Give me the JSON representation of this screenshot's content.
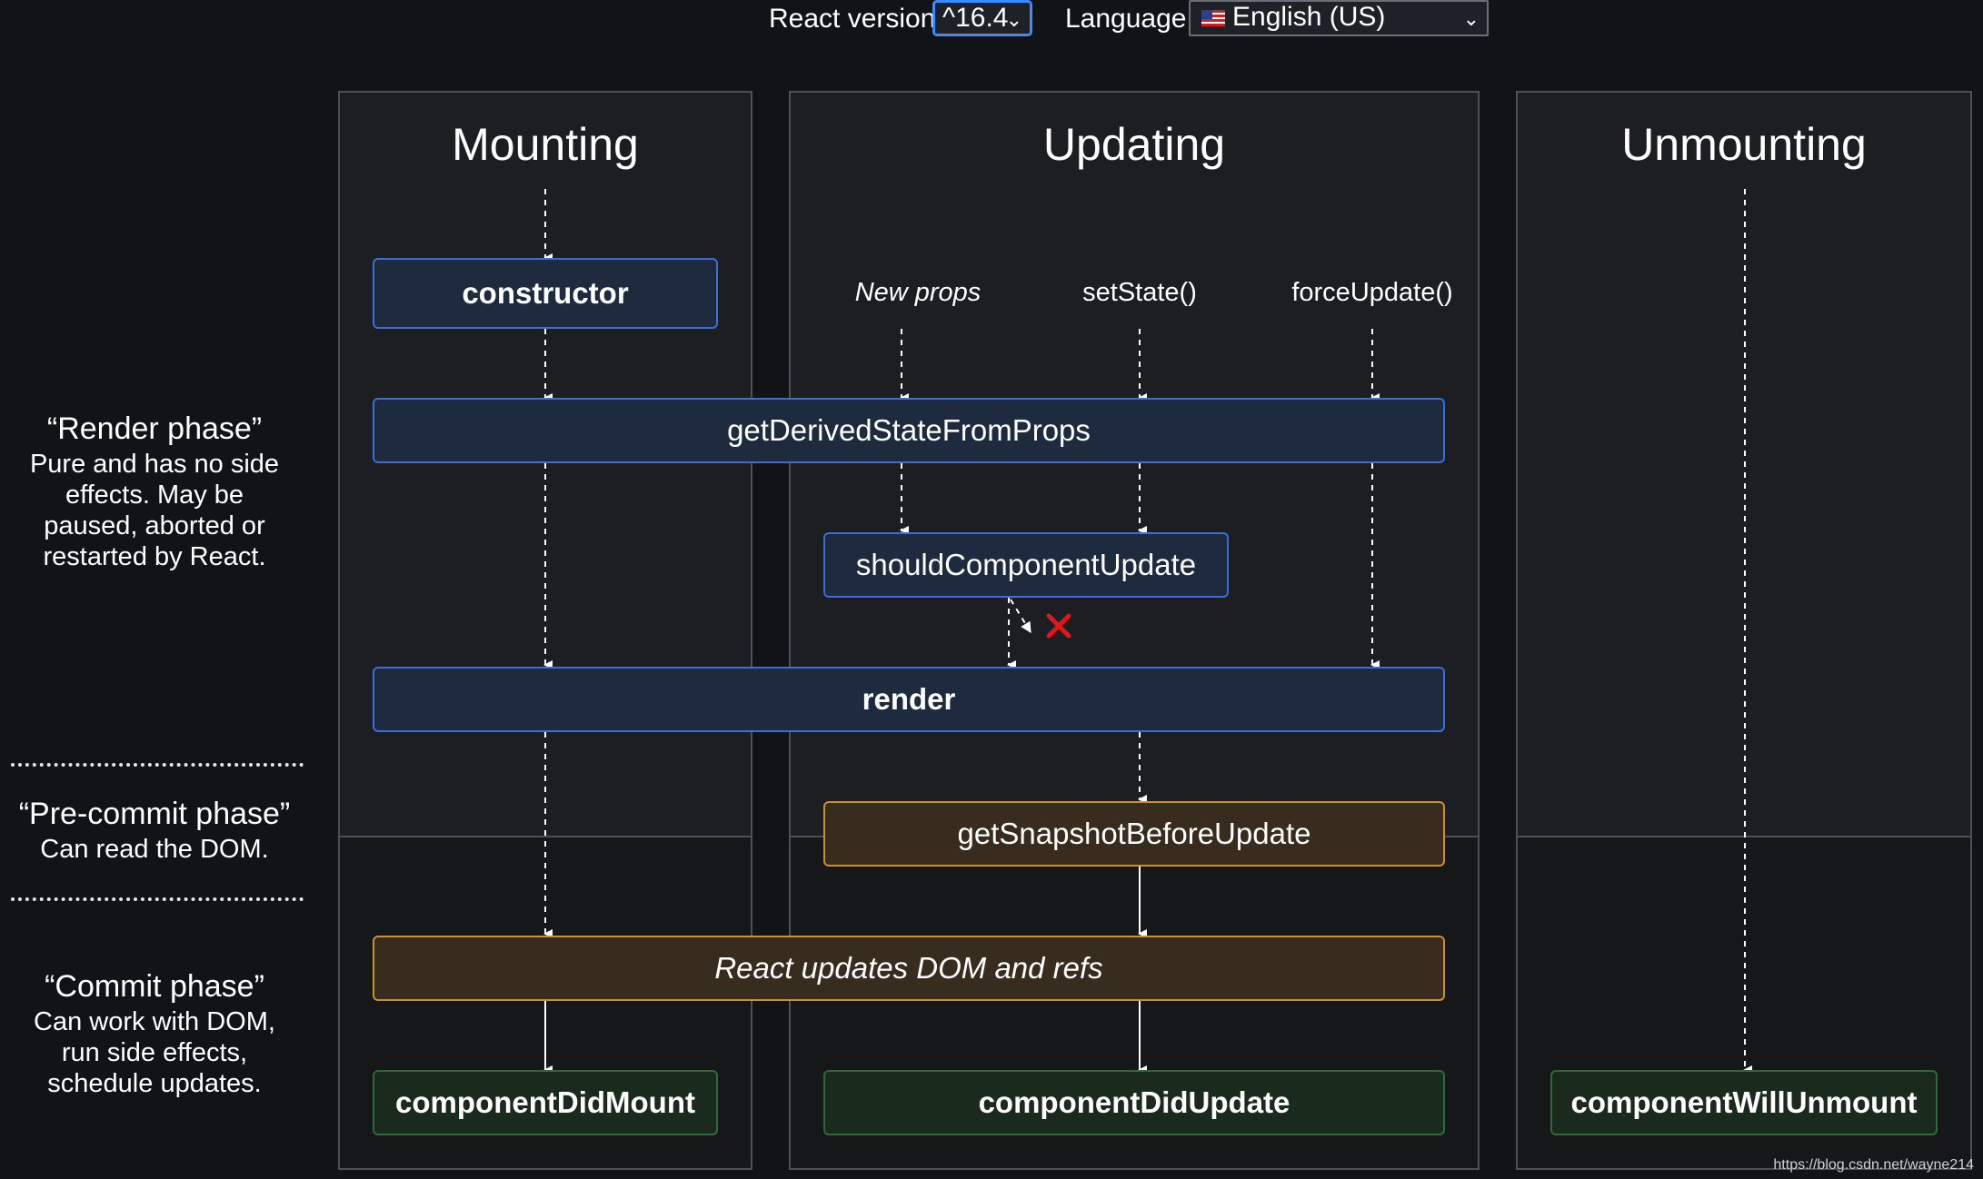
{
  "controls": {
    "version_label": "React version",
    "version_value": "^16.4",
    "language_label": "Language",
    "language_value": "English (US)"
  },
  "columns": {
    "mounting": "Mounting",
    "updating": "Updating",
    "unmounting": "Unmounting"
  },
  "phases": {
    "render_title": "“Render phase”",
    "render_desc": [
      "Pure and has no side",
      "effects. May be",
      "paused, aborted or",
      "restarted by React."
    ],
    "precommit_title": "“Pre-commit phase”",
    "precommit_desc": [
      "Can read the DOM."
    ],
    "commit_title": "“Commit phase”",
    "commit_desc": [
      "Can work with DOM,",
      "run side effects,",
      "schedule updates."
    ]
  },
  "triggers": {
    "new_props": "New props",
    "set_state": "setState()",
    "force_update": "forceUpdate()"
  },
  "methods": {
    "constructor": "constructor",
    "get_derived": "getDerivedStateFromProps",
    "should_update": "shouldComponentUpdate",
    "render": "render",
    "get_snapshot": "getSnapshotBeforeUpdate",
    "dom_update": "React updates DOM and refs",
    "did_mount": "componentDidMount",
    "did_update": "componentDidUpdate",
    "will_unmount": "componentWillUnmount"
  },
  "colors": {
    "render_box": "#1e2a3e",
    "precommit_box": "#372c1e",
    "commit_box": "#1a2a1c",
    "cancel_mark": "#e0161b"
  },
  "watermark": "https://blog.csdn.net/wayne214"
}
